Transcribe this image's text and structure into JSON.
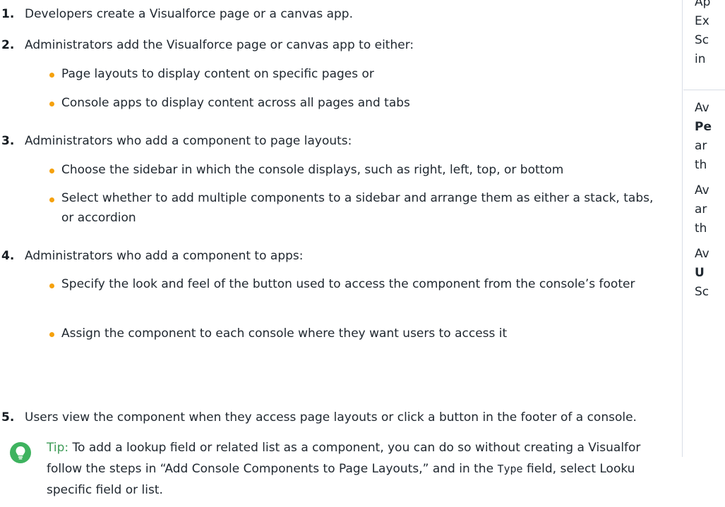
{
  "steps": [
    {
      "num": "1.",
      "text": "Developers create a Visualforce page or a canvas app."
    },
    {
      "num": "2.",
      "text": "Administrators add the Visualforce page or canvas app to either:",
      "bullets": [
        "Page layouts to display content on specific pages or",
        "Console apps to display content across all pages and tabs"
      ]
    },
    {
      "num": "3.",
      "text": "Administrators who add a component to page layouts:",
      "bullets": [
        "Choose the sidebar in which the console displays, such as right, left, top, or bottom",
        "Select whether to add multiple components to a sidebar and arrange them as either a stack, tabs, or accordion"
      ]
    },
    {
      "num": "4.",
      "text": "Administrators who add a component to apps:",
      "bullets": [
        "Specify the look and feel of the button used to access the component from the console’s footer",
        "Assign the component to each console where they want users to access it"
      ]
    },
    {
      "num": "5.",
      "text": "Users view the component when they access page layouts or click a button in the footer of a console."
    }
  ],
  "tip": {
    "label": "Tip:",
    "line1": "To add a lookup field or related list as a component, you can do so without creating a Visualfor",
    "line2_before": "follow the steps in “Add Console Components to Page Layouts,” and in the ",
    "line2_code": "Type",
    "line2_after": " field, select Looku",
    "line3": "specific field or list."
  },
  "sidebar": {
    "lines": [
      "Ap",
      "Ex",
      "Sc",
      "in"
    ],
    "lines2": [
      {
        "text": "Av",
        "bold": false
      },
      {
        "text": "Pe",
        "bold": true
      },
      {
        "text": "ar",
        "bold": false
      },
      {
        "text": "th",
        "bold": false
      }
    ],
    "lines3": [
      "Av",
      "ar",
      "th"
    ],
    "lines4": [
      {
        "text": "Av",
        "bold": false
      },
      {
        "text": "U",
        "bold": true
      },
      {
        "text": "Sc",
        "bold": false
      }
    ]
  },
  "colors": {
    "bullet": "#f5a10d",
    "tip_icon": "#3eb35f",
    "tip_label": "#3e9b57"
  },
  "icons": {
    "tip": "lightbulb-icon"
  }
}
